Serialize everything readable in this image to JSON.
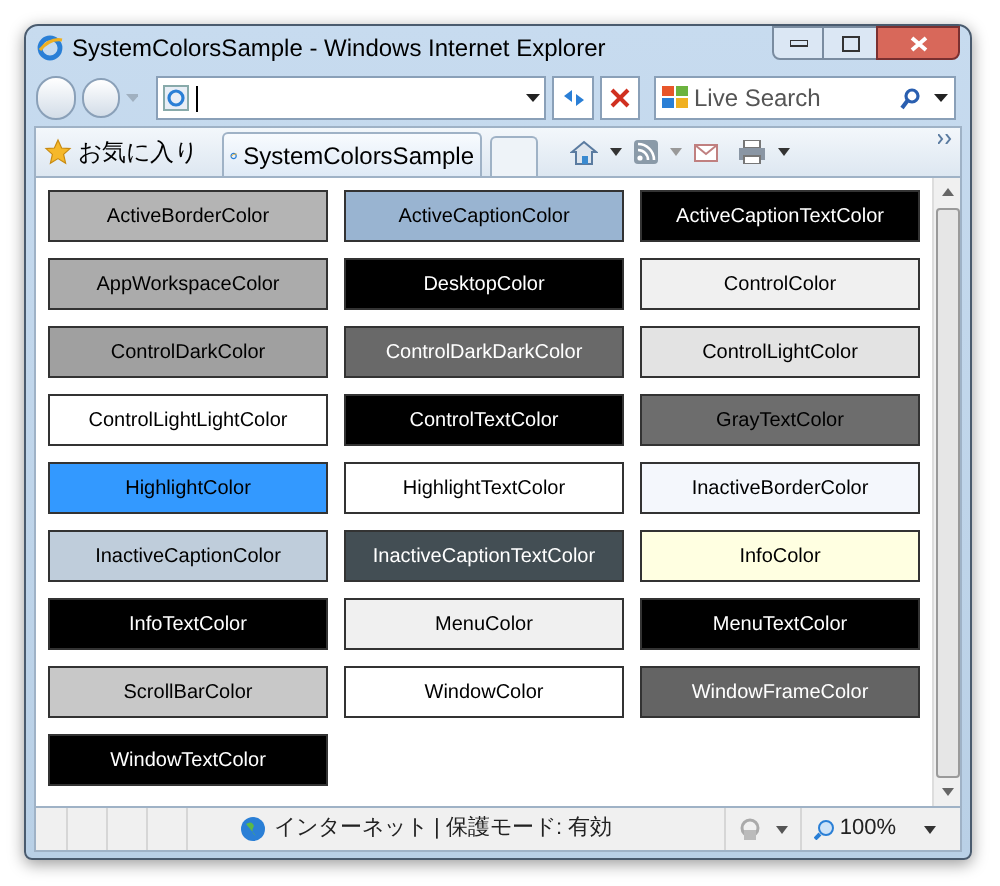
{
  "window": {
    "title": "SystemColorsSample - Windows Internet Explorer"
  },
  "search": {
    "placeholder": "Live Search"
  },
  "favorites": {
    "label": "お気に入り"
  },
  "tab": {
    "label": "SystemColorsSample",
    "selected": true
  },
  "swatches": [
    {
      "label": "ActiveBorderColor",
      "color": "#b4b4b4",
      "kind": "light"
    },
    {
      "label": "ActiveCaptionColor",
      "color": "#99b4d1",
      "kind": "light"
    },
    {
      "label": "ActiveCaptionTextColor",
      "color": "#000000",
      "kind": "dark"
    },
    {
      "label": "AppWorkspaceColor",
      "color": "#ababab",
      "kind": "light"
    },
    {
      "label": "DesktopColor",
      "color": "#000000",
      "kind": "dark"
    },
    {
      "label": "ControlColor",
      "color": "#f0f0f0",
      "kind": "light"
    },
    {
      "label": "ControlDarkColor",
      "color": "#a0a0a0",
      "kind": "light"
    },
    {
      "label": "ControlDarkDarkColor",
      "color": "#696969",
      "kind": "dark"
    },
    {
      "label": "ControlLightColor",
      "color": "#e3e3e3",
      "kind": "light"
    },
    {
      "label": "ControlLightLightColor",
      "color": "#ffffff",
      "kind": "light"
    },
    {
      "label": "ControlTextColor",
      "color": "#000000",
      "kind": "dark"
    },
    {
      "label": "GrayTextColor",
      "color": "#6d6d6d",
      "kind": "light"
    },
    {
      "label": "HighlightColor",
      "color": "#3399ff",
      "kind": "light"
    },
    {
      "label": "HighlightTextColor",
      "color": "#ffffff",
      "kind": "light"
    },
    {
      "label": "InactiveBorderColor",
      "color": "#f4f7fc",
      "kind": "light"
    },
    {
      "label": "InactiveCaptionColor",
      "color": "#bfcddb",
      "kind": "light"
    },
    {
      "label": "InactiveCaptionTextColor",
      "color": "#434e54",
      "kind": "dark"
    },
    {
      "label": "InfoColor",
      "color": "#ffffe1",
      "kind": "light"
    },
    {
      "label": "InfoTextColor",
      "color": "#000000",
      "kind": "dark"
    },
    {
      "label": "MenuColor",
      "color": "#f0f0f0",
      "kind": "light"
    },
    {
      "label": "MenuTextColor",
      "color": "#000000",
      "kind": "dark"
    },
    {
      "label": "ScrollBarColor",
      "color": "#c8c8c8",
      "kind": "light"
    },
    {
      "label": "WindowColor",
      "color": "#ffffff",
      "kind": "light"
    },
    {
      "label": "WindowFrameColor",
      "color": "#646464",
      "kind": "dark"
    },
    {
      "label": "WindowTextColor",
      "color": "#000000",
      "kind": "dark"
    }
  ],
  "status_bar": {
    "zone": "インターネット | 保護モード: 有効",
    "zoom": "100%"
  }
}
